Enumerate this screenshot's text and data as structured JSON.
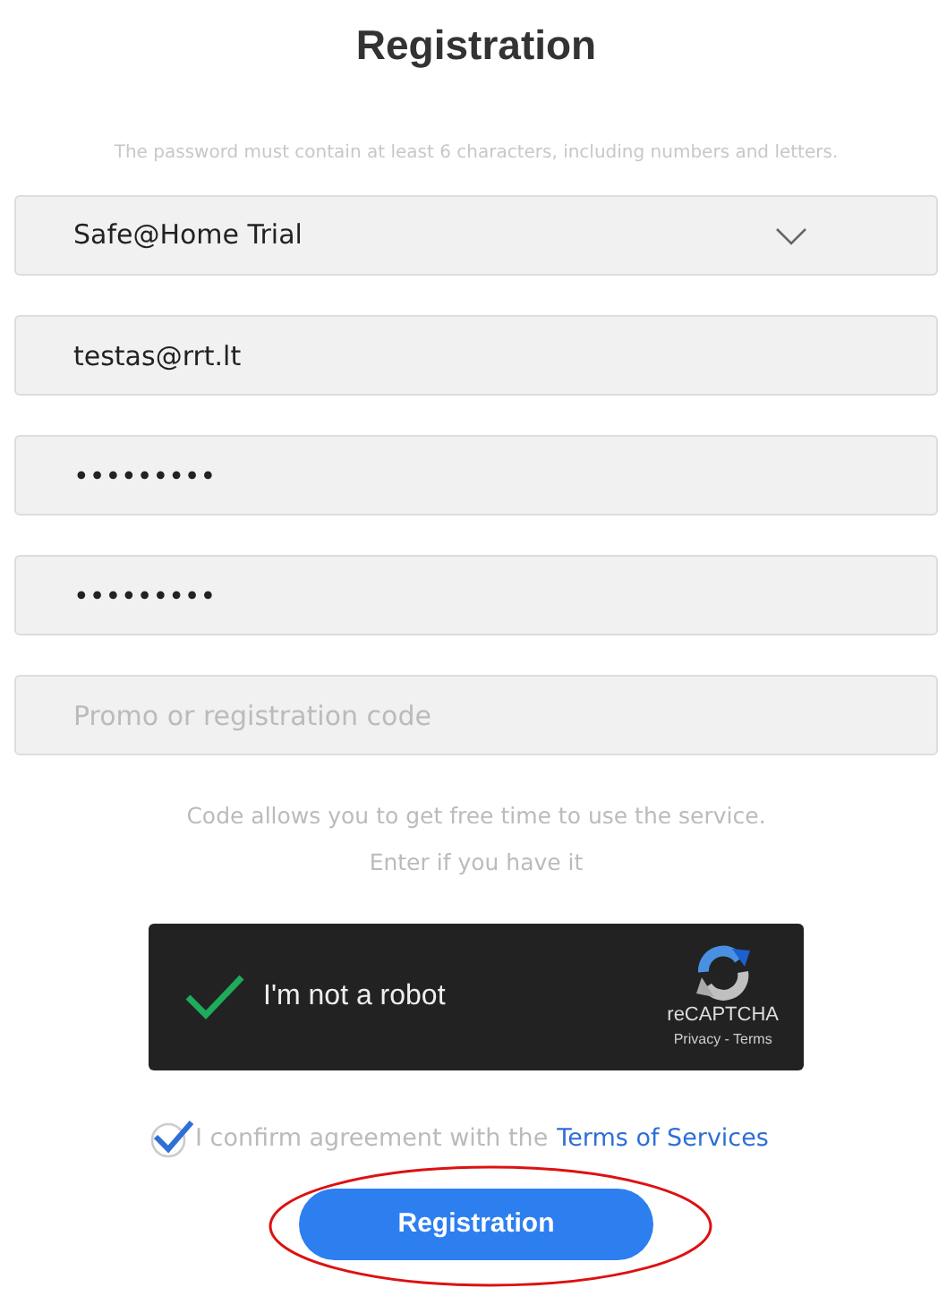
{
  "title": "Registration",
  "password_hint": "The password must contain at least 6 characters, including numbers and letters.",
  "fields": [
    {
      "kind": "select",
      "value": "Safe@Home Trial"
    },
    {
      "kind": "text",
      "value": "testas@rrt.lt"
    },
    {
      "kind": "text",
      "value": "•••••••••"
    },
    {
      "kind": "text",
      "value": "•••••••••"
    },
    {
      "kind": "text",
      "placeholder": "Promo or registration code"
    }
  ],
  "code_hint": [
    "Code allows you to get free time to use the service.",
    "Enter if you have it"
  ],
  "captcha": {
    "checked": true,
    "label": "I'm not a robot",
    "brand": "reCAPTCHA",
    "links": "Privacy - Terms"
  },
  "agreement": {
    "checked": true,
    "text": "I confirm agreement with the",
    "link": "Terms of Services"
  },
  "submit": {
    "label": "Registration",
    "highlighted": true
  }
}
